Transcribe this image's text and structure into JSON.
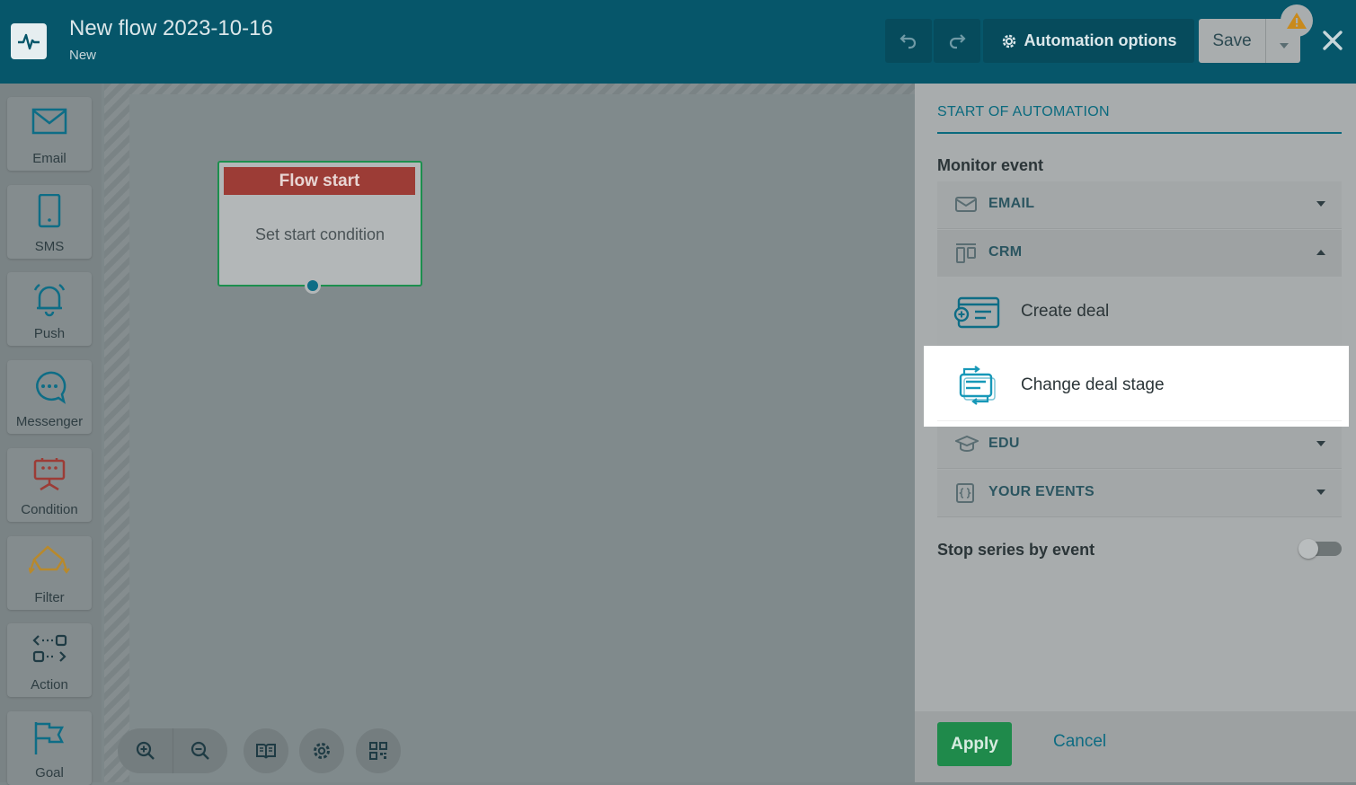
{
  "header": {
    "title": "New flow 2023-10-16",
    "subtitle": "New",
    "automation_options_label": "Automation options",
    "save_label": "Save"
  },
  "toolbar": {
    "items": [
      {
        "label": "Email",
        "icon": "envelope-icon"
      },
      {
        "label": "SMS",
        "icon": "phone-icon"
      },
      {
        "label": "Push",
        "icon": "bell-icon"
      },
      {
        "label": "Messenger",
        "icon": "chat-bubble-icon"
      },
      {
        "label": "Condition",
        "icon": "condition-icon"
      },
      {
        "label": "Filter",
        "icon": "filter-icon"
      },
      {
        "label": "Action",
        "icon": "action-icon"
      },
      {
        "label": "Goal",
        "icon": "flag-icon"
      }
    ]
  },
  "canvas": {
    "node_title": "Flow start",
    "node_body": "Set start condition"
  },
  "panel": {
    "title": "START OF AUTOMATION",
    "monitor_label": "Monitor event",
    "groups": [
      {
        "label": "EMAIL",
        "expanded": false
      },
      {
        "label": "CRM",
        "expanded": true
      },
      {
        "label": "EDU",
        "expanded": false
      },
      {
        "label": "YOUR EVENTS",
        "expanded": false
      }
    ],
    "crm_items": [
      {
        "label": "Create deal"
      },
      {
        "label": "Change deal stage"
      }
    ],
    "stop_label": "Stop series by event",
    "stop_enabled": false,
    "apply_label": "Apply",
    "cancel_label": "Cancel"
  },
  "colors": {
    "header": "#06566a",
    "accent": "#0a6a7e",
    "apply": "#1f8a4b",
    "node_head": "#9c3c36",
    "node_border": "#1d8f4e"
  }
}
